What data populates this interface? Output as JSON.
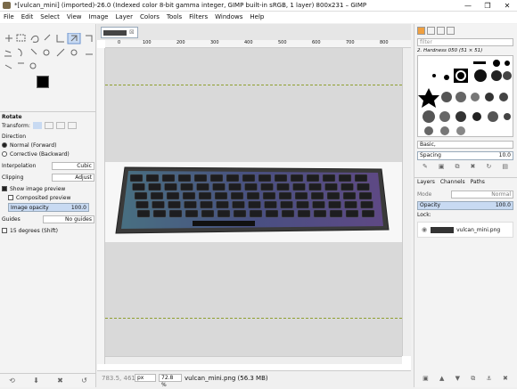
{
  "window": {
    "title": "*[vulcan_mini] (imported)-26.0 (Indexed color 8-bit gamma integer, GIMP built-in sRGB, 1 layer) 800x231 – GIMP",
    "controls": {
      "minimize": "—",
      "maximize": "❐",
      "close": "✕"
    }
  },
  "menu": [
    "File",
    "Edit",
    "Select",
    "View",
    "Image",
    "Layer",
    "Colors",
    "Tools",
    "Filters",
    "Windows",
    "Help"
  ],
  "tool_options": {
    "title": "Rotate",
    "transform_label": "Transform:",
    "direction_label": "Direction",
    "direction_normal": "Normal (Forward)",
    "direction_corrective": "Corrective (Backward)",
    "interpolation_label": "Interpolation",
    "interpolation_value": "Cubic",
    "clipping_label": "Clipping",
    "clipping_value": "Adjust",
    "show_preview": "Show image preview",
    "composited_preview": "Composited preview",
    "image_opacity_label": "Image opacity",
    "image_opacity_value": "100.0",
    "guides_label": "Guides",
    "guides_value": "No guides",
    "degrees": "15 degrees (Shift)"
  },
  "canvas": {
    "image_tab_close": "⊠",
    "ruler_marks": [
      "0",
      "100",
      "200",
      "300",
      "400",
      "500",
      "600",
      "700",
      "800"
    ]
  },
  "statusbar": {
    "coords": "783.5, 461.9",
    "unit": "px",
    "zoom": "72.8 %",
    "info": "vulcan_mini.png (56.3 MB)"
  },
  "brushes": {
    "filter_placeholder": "filter",
    "selected": "2. Hardness 050 (51 × 51)",
    "preset": "Basic,",
    "spacing_label": "Spacing",
    "spacing_value": "10.0"
  },
  "layers": {
    "tabs": [
      "Layers",
      "Channels",
      "Paths"
    ],
    "mode_label": "Mode",
    "mode_value": "Normal",
    "opacity_label": "Opacity",
    "opacity_value": "100.0",
    "lock_label": "Lock:",
    "layer_name": "vulcan_mini.png"
  },
  "colors": {
    "accent": "#3875d7",
    "guide": "#8fa030",
    "fg": "#000000",
    "bg": "#ffffff"
  }
}
